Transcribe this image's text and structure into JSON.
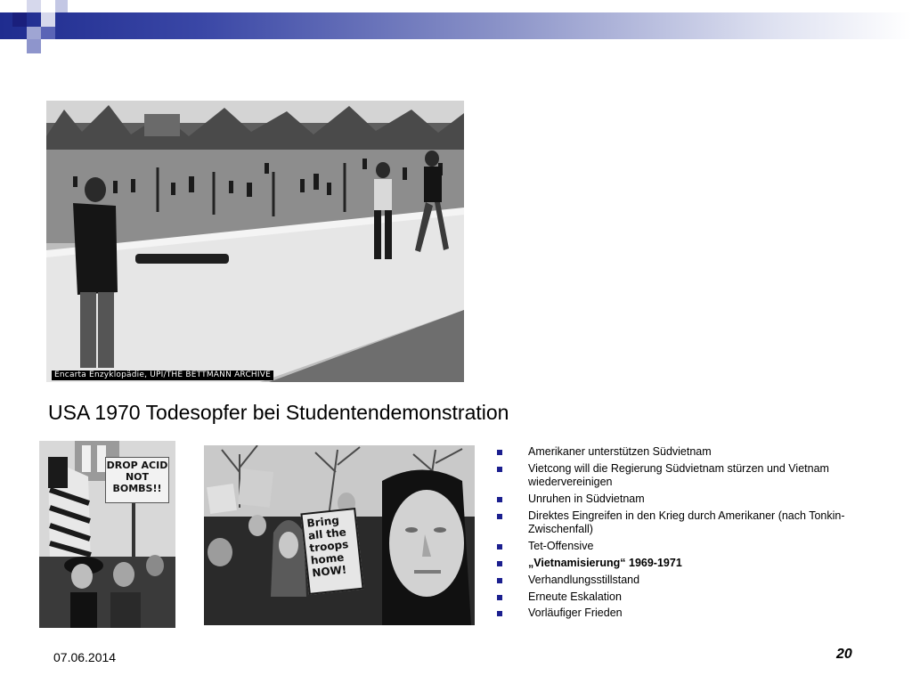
{
  "slide": {
    "title": "USA 1970 Todesopfer bei Studentendemonstration",
    "photo_credit": "Encarta Enzyklopädie, UPI/THE BETTMANN ARCHIVE",
    "sign_left": [
      "DROP ACID",
      "NOT",
      "BOMBS!!"
    ],
    "sign_mid": [
      "Bring",
      "all the",
      "troops",
      "home",
      "NOW!"
    ],
    "bullets": [
      {
        "text": "Amerikaner unterstützen Südvietnam",
        "bold": false
      },
      {
        "text": "Vietcong will die Regierung Südvietnam stürzen und Vietnam wiedervereinigen",
        "bold": false
      },
      {
        "text": "Unruhen in Südvietnam",
        "bold": false
      },
      {
        "text": "Direktes Eingreifen in den Krieg durch Amerikaner (nach Tonkin-Zwischenfall)",
        "bold": false
      },
      {
        "text": "Tet-Offensive",
        "bold": false
      },
      {
        "text": "„Vietnamisierung“ 1969-1971",
        "bold": true
      },
      {
        "text": "Verhandlungsstillstand",
        "bold": false
      },
      {
        "text": "Erneute Eskalation",
        "bold": false
      },
      {
        "text": "Vorläufiger Frieden",
        "bold": false
      }
    ],
    "footer_date": "07.06.2014",
    "page_number": "20"
  },
  "colors": {
    "accent": "#1f2c8f",
    "bullet": "#1b1f8f"
  }
}
